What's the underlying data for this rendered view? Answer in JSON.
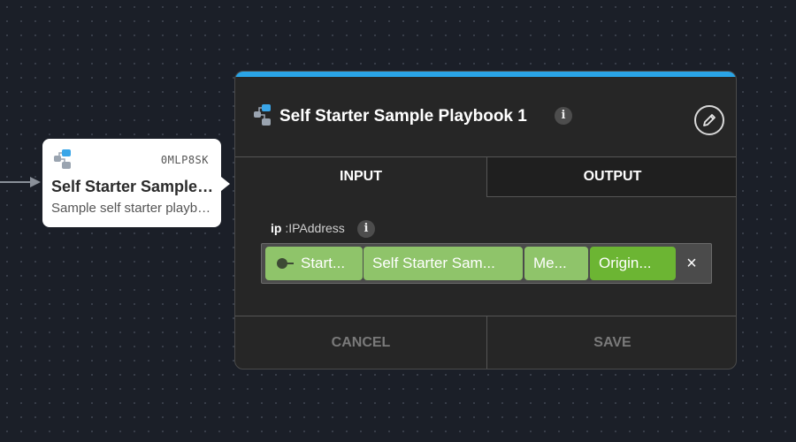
{
  "node": {
    "code": "0MLP8SK",
    "title": "Self Starter Sample Playbook 1",
    "subtitle": "Sample self starter playbook",
    "icon": "playbook-icon"
  },
  "panel": {
    "title": "Self Starter Sample Playbook 1",
    "accent_color": "#2aa4e6",
    "tabs": [
      {
        "label": "INPUT",
        "active": true
      },
      {
        "label": "OUTPUT",
        "active": false
      }
    ],
    "field": {
      "name": "ip",
      "type": ":IPAddress"
    },
    "path_chips": [
      {
        "label": "Start..."
      },
      {
        "label": "Self Starter Sam..."
      },
      {
        "label": "Me..."
      },
      {
        "label": "Origin..."
      }
    ],
    "clear_symbol": "×",
    "cancel_label": "CANCEL",
    "save_label": "SAVE",
    "info_symbol": "i"
  }
}
